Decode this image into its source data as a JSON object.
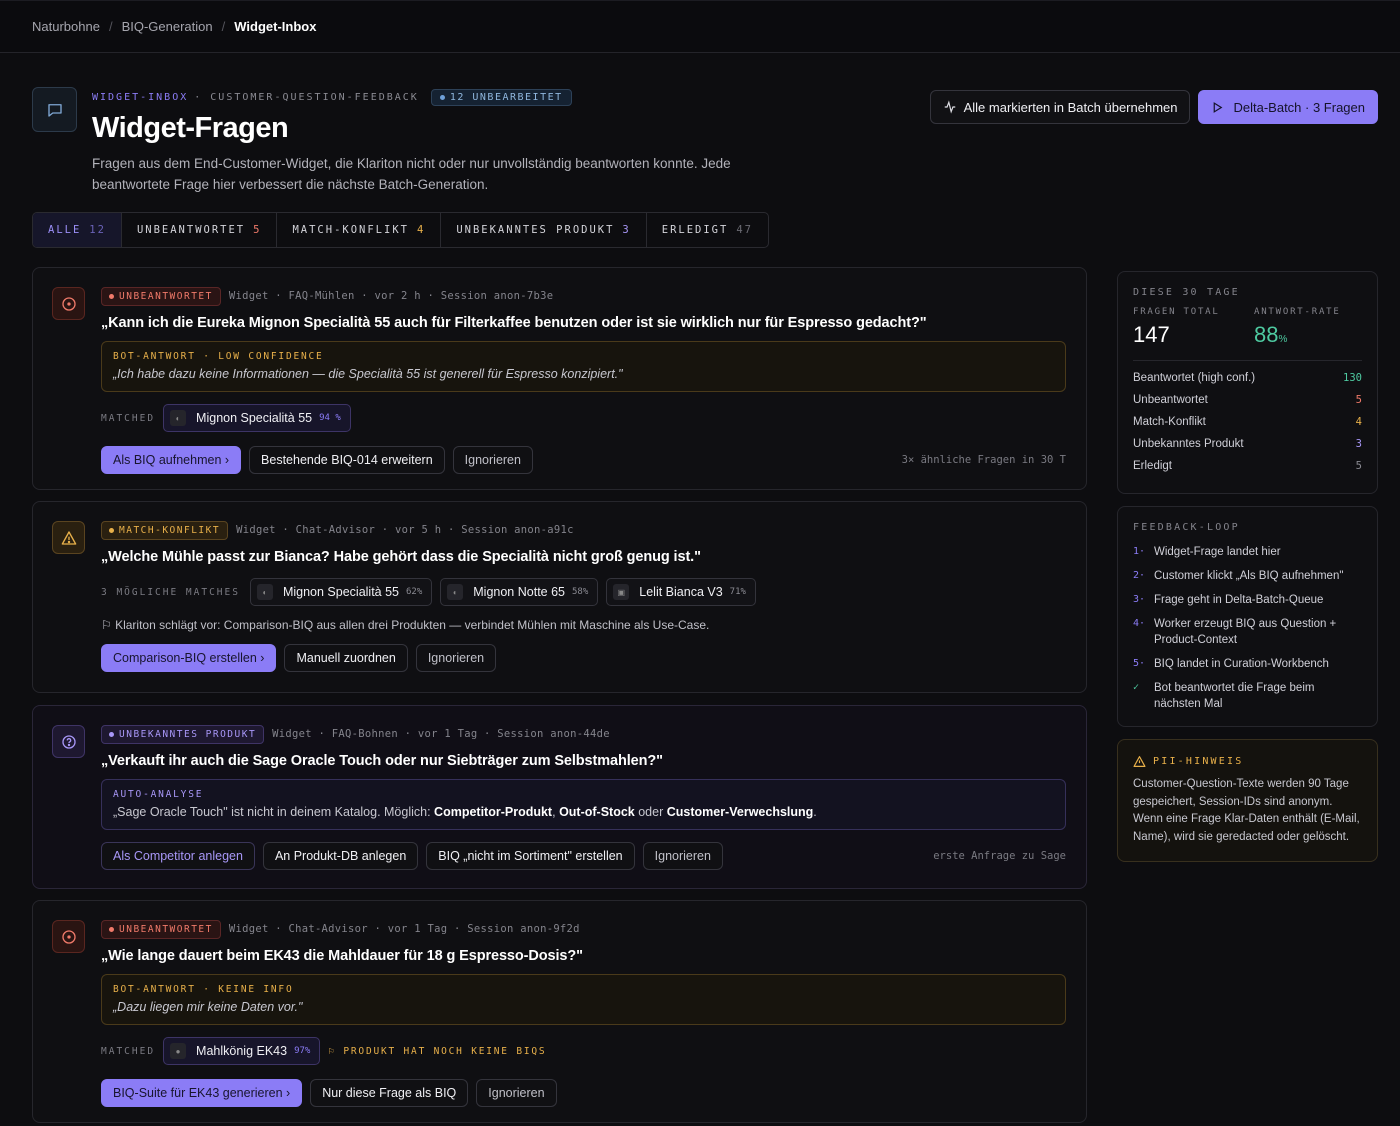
{
  "breadcrumb": [
    "Naturbohne",
    "BIQ-Generation",
    "Widget-Inbox"
  ],
  "header": {
    "eyebrow_a": "WIDGET-INBOX",
    "eyebrow_b": "· CUSTOMER-QUESTION-FEEDBACK",
    "badge": "12 UNBEARBEITET",
    "title": "Widget-Fragen",
    "description": "Fragen aus dem End-Customer-Widget, die Klariton nicht oder nur unvollständig beantworten konnte. Jede beantwortete Frage hier verbessert die nächste Batch-Generation.",
    "btn_batch": "Alle markierten in Batch übernehmen",
    "btn_delta": "Delta-Batch · 3 Fragen"
  },
  "tabs": [
    {
      "label": "ALLE",
      "count": "12"
    },
    {
      "label": "UNBEANTWORTET",
      "count": "5"
    },
    {
      "label": "MATCH-KONFLIKT",
      "count": "4"
    },
    {
      "label": "UNBEKANNTES PRODUKT",
      "count": "3"
    },
    {
      "label": "ERLEDIGT",
      "count": "47"
    }
  ],
  "cards": [
    {
      "badge": "UNBEANTWORTET",
      "meta": "Widget · FAQ-Mühlen · vor 2 h · Session anon-7b3e",
      "question": "„Kann ich die Eureka Mignon Specialità 55 auch für Filterkaffee benutzen oder ist sie wirklich nur für Espresso gedacht?\"",
      "answer_label": "BOT-ANTWORT · LOW CONFIDENCE",
      "answer_text": "„Ich habe dazu keine Informationen — die Specialità 55 ist generell für Espresso konzipiert.\"",
      "match_label": "MATCHED",
      "match_name": "Mignon Specialità 55",
      "match_pct": "94 %",
      "actions": [
        "Als BIQ aufnehmen ›",
        "Bestehende BIQ-014 erweitern",
        "Ignorieren"
      ],
      "note": "3× ähnliche Fragen in 30 T"
    },
    {
      "badge": "MATCH-KONFLIKT",
      "meta": "Widget · Chat-Advisor · vor 5 h · Session anon-a91c",
      "question": "„Welche Mühle passt zur Bianca? Habe gehört dass die Specialità nicht groß genug ist.\"",
      "match_label": "3 MÖGLICHE MATCHES",
      "matches": [
        {
          "name": "Mignon Specialità 55",
          "pct": "62%"
        },
        {
          "name": "Mignon Notte 65",
          "pct": "58%"
        },
        {
          "name": "Lelit Bianca V3",
          "pct": "71%"
        }
      ],
      "suggestion": "⚐ Klariton schlägt vor: Comparison-BIQ aus allen drei Produkten — verbindet Mühlen mit Maschine als Use-Case.",
      "actions": [
        "Comparison-BIQ erstellen ›",
        "Manuell zuordnen",
        "Ignorieren"
      ]
    },
    {
      "badge": "UNBEKANNTES PRODUKT",
      "meta": "Widget · FAQ-Bohnen · vor 1 Tag · Session anon-44de",
      "question": "„Verkauft ihr auch die Sage Oracle Touch oder nur Siebträger zum Selbstmahlen?\"",
      "answer_label": "AUTO-ANALYSE",
      "answer_pre": "„Sage Oracle Touch\" ist nicht in deinem Katalog. Möglich: ",
      "answer_b1": "Competitor-Produkt",
      "answer_sep1": ", ",
      "answer_b2": "Out-of-Stock",
      "answer_sep2": " oder ",
      "answer_b3": "Customer-Verwechslung",
      "answer_end": ".",
      "actions": [
        "Als Competitor anlegen",
        "An Produkt-DB anlegen",
        "BIQ „nicht im Sortiment\" erstellen",
        "Ignorieren"
      ],
      "note": "erste Anfrage zu Sage"
    },
    {
      "badge": "UNBEANTWORTET",
      "meta": "Widget · Chat-Advisor · vor 1 Tag · Session anon-9f2d",
      "question": "„Wie lange dauert beim EK43 die Mahldauer für 18 g Espresso-Dosis?\"",
      "answer_label": "BOT-ANTWORT · KEINE INFO",
      "answer_text": "„Dazu liegen mir keine Daten vor.\"",
      "match_label": "MATCHED",
      "match_name": "Mahlkönig EK43",
      "match_pct": "97%",
      "warn": "⚐ PRODUKT HAT NOCH KEINE BIQS",
      "actions": [
        "BIQ-Suite für EK43 generieren ›",
        "Nur diese Frage als BIQ",
        "Ignorieren"
      ]
    }
  ],
  "stats": {
    "title": "DIESE 30 TAGE",
    "total_label": "FRAGEN TOTAL",
    "total": "147",
    "rate_label": "ANTWORT-RATE",
    "rate": "88",
    "rate_unit": "%",
    "rows": [
      {
        "label": "Beantwortet (high conf.)",
        "value": "130",
        "color": "#4ec9a0"
      },
      {
        "label": "Unbeantwortet",
        "value": "5",
        "color": "#f07a6a"
      },
      {
        "label": "Match-Konflikt",
        "value": "4",
        "color": "#e8b04a"
      },
      {
        "label": "Unbekanntes Produkt",
        "value": "3",
        "color": "#a897f7"
      },
      {
        "label": "Erledigt",
        "value": "5",
        "color": "#8a8a92"
      }
    ]
  },
  "loop": {
    "title": "FEEDBACK-LOOP",
    "steps": [
      {
        "n": "1·",
        "text": "Widget-Frage landet hier"
      },
      {
        "n": "2·",
        "text": "Customer klickt „Als BIQ aufnehmen\""
      },
      {
        "n": "3·",
        "text": "Frage geht in Delta-Batch-Queue"
      },
      {
        "n": "4·",
        "text": "Worker erzeugt BIQ aus Question + Product-Context"
      },
      {
        "n": "5·",
        "text": "BIQ landet in Curation-Workbench"
      },
      {
        "n": "✓",
        "text": "Bot beantwortet die Frage beim nächsten Mal"
      }
    ]
  },
  "pii": {
    "title": "PII-HINWEIS",
    "text": "Customer-Question-Texte werden 90 Tage gespeichert, Session-IDs sind anonym. Wenn eine Frage Klar-Daten enthält (E-Mail, Name), wird sie geredacted oder gelöscht."
  }
}
